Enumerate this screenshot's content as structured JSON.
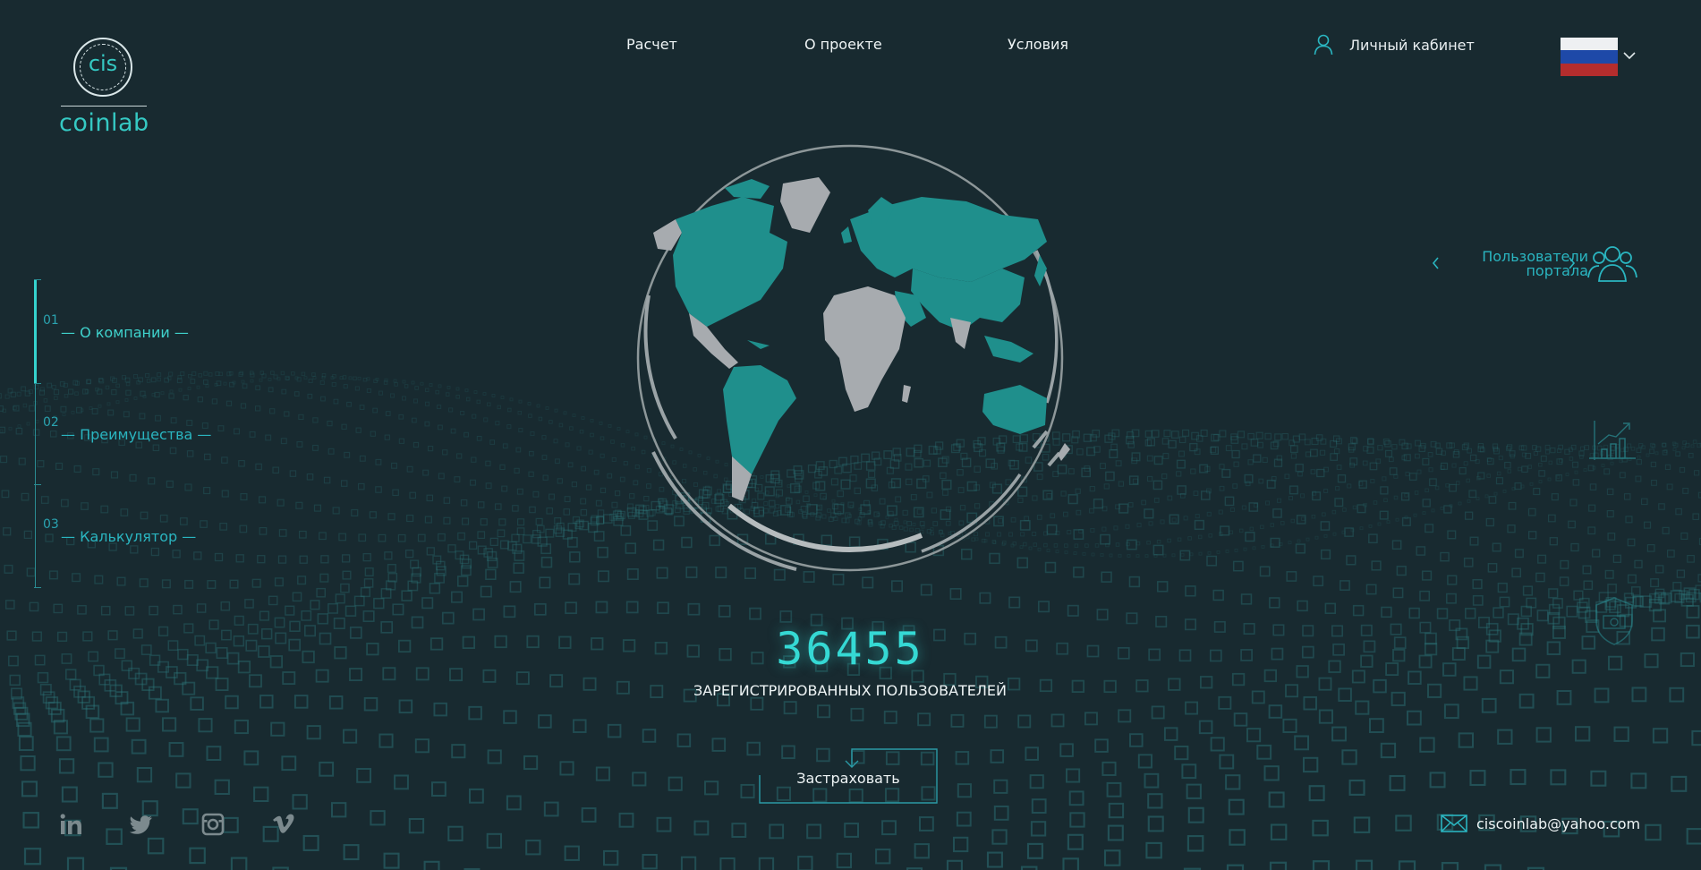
{
  "brand": {
    "coin_text": "cis",
    "wordmark": "coinlab"
  },
  "nav": {
    "items": [
      "Расчет",
      "О проекте",
      "Условия"
    ]
  },
  "account": {
    "label": "Личный кабинет",
    "icon": "user-icon"
  },
  "language": {
    "flag": "ru",
    "icon": "chevron-down-icon"
  },
  "sections": [
    {
      "num": "01",
      "label": "— О компании —",
      "active": true
    },
    {
      "num": "02",
      "label": "— Преимущества —",
      "active": false
    },
    {
      "num": "03",
      "label": "— Калькулятор —",
      "active": false
    }
  ],
  "side_panel": {
    "users_label_line1": "Пользователи",
    "users_label_line2": "портала",
    "icons": [
      "users-icon",
      "growth-chart-icon",
      "shield-money-icon"
    ]
  },
  "stats": {
    "count": "36455",
    "label": "ЗАРЕГИСТРИРОВАННЫХ ПОЛЬЗОВАТЕЛЕЙ"
  },
  "cta": {
    "label": "Застраховать"
  },
  "footer": {
    "socials": [
      "linkedin-icon",
      "twitter-icon",
      "instagram-icon",
      "vimeo-icon"
    ],
    "email": "ciscoinlab@yahoo.com"
  },
  "colors": {
    "background": "#182a30",
    "accent": "#35d3ce",
    "accent_dim": "#2ab5c0",
    "map_land": "#1f8f8c",
    "map_grey": "#a7abaf"
  }
}
